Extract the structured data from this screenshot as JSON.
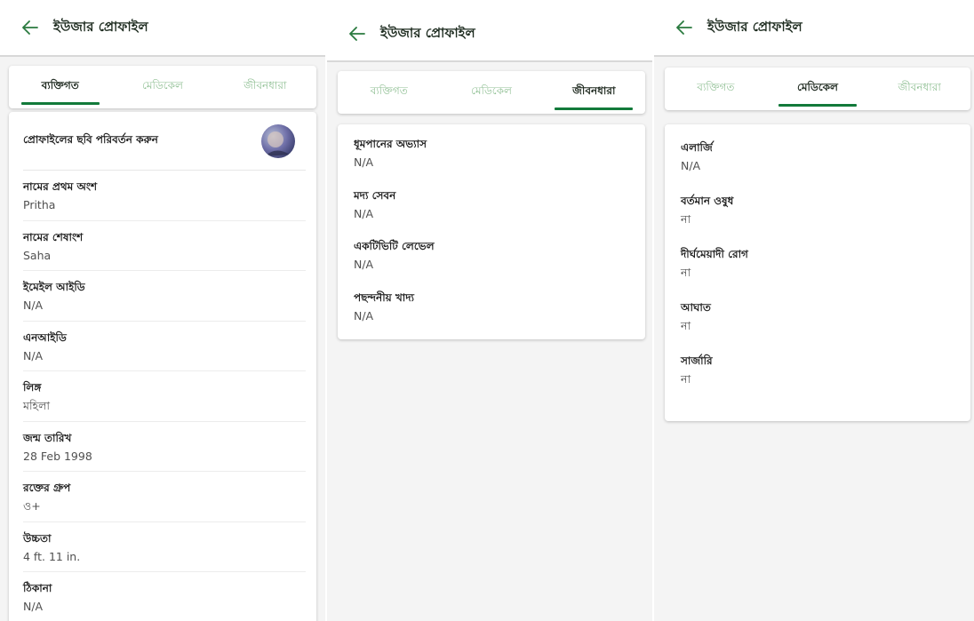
{
  "colors": {
    "brand_green": "#127a3a",
    "inactive_tab": "#8fbf93",
    "background": "#f4f4f4"
  },
  "appbar": {
    "title": "ইউজার প্রোফাইল",
    "back_icon": "arrow-left-icon"
  },
  "tabs": {
    "personal": "ব্যক্তিগত",
    "medical": "মেডিকেল",
    "lifestyle": "জীবনধারা"
  },
  "personal": {
    "change_photo": "প্রোফাইলের ছবি পরিবর্তন করুন",
    "fields": [
      {
        "label": "নামের প্রথম অংশ",
        "value": "Pritha"
      },
      {
        "label": "নামের শেষাংশ",
        "value": "Saha"
      },
      {
        "label": "ইমেইল আইডি",
        "value": "N/A"
      },
      {
        "label": "এনআইডি",
        "value": "N/A"
      },
      {
        "label": "লিঙ্গ",
        "value": "মহিলা"
      },
      {
        "label": "জন্ম তারিখ",
        "value": "28 Feb 1998"
      },
      {
        "label": "রক্তের গ্রুপ",
        "value": "ও+"
      },
      {
        "label": "উচ্চতা",
        "value": "4 ft. 11 in."
      },
      {
        "label": "ঠিকানা",
        "value": "N/A"
      }
    ]
  },
  "lifestyle": {
    "fields": [
      {
        "label": "ধূমপানের অভ্যাস",
        "value": "N/A"
      },
      {
        "label": "মদ্য সেবন",
        "value": "N/A"
      },
      {
        "label": "একটিভিটি লেভেল",
        "value": "N/A"
      },
      {
        "label": "পছন্দনীয় খাদ্য",
        "value": "N/A"
      }
    ]
  },
  "medical": {
    "fields": [
      {
        "label": "এলার্জি",
        "value": "N/A"
      },
      {
        "label": "বর্তমান ওষুধ",
        "value": "না"
      },
      {
        "label": "দীর্ঘমেয়াদী রোগ",
        "value": "না"
      },
      {
        "label": "আঘাত",
        "value": "না"
      },
      {
        "label": "সার্জারি",
        "value": "না"
      }
    ]
  }
}
